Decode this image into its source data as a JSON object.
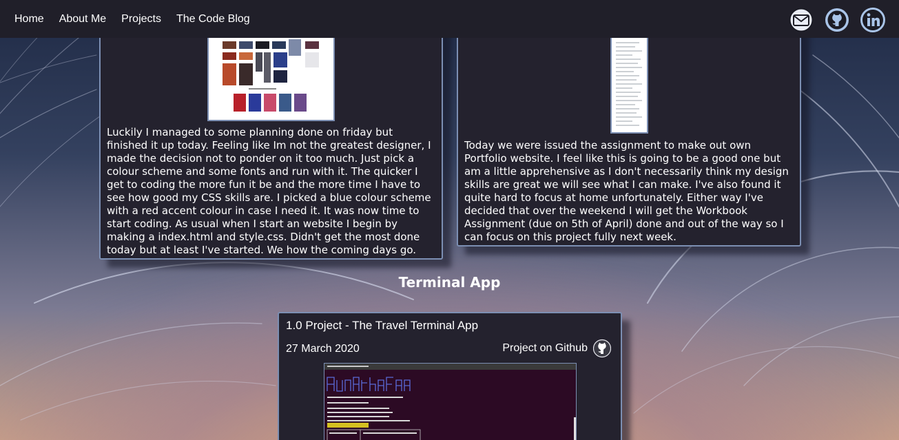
{
  "nav": {
    "links": [
      "Home",
      "About Me",
      "Projects",
      "The Code Blog"
    ],
    "icons": [
      "email-icon",
      "github-icon",
      "linkedin-icon"
    ]
  },
  "blog": {
    "left_post": "Luckily I managed to some planning done on friday but finished it up today. Feeling like Im not the greatest designer, I made the decision not to ponder on it too much. Just pick a colour scheme and some fonts and run with it. The quicker I get to coding the more fun it be and the more time I have to see how good my CSS skills are. I picked a blue colour scheme with a red accent colour in case I need it. It was now time to start coding. As usual when I start an website I begin by making a index.html and style.css. Didn't get the most done today but at least I've started. We how the coming days go.",
    "right_post": "Today we were issued the assignment to make out own Portfolio website. I feel like this is going to be a good one but am a little apprehensive as I don't necessarily think my design skills are great we will see what I can make. I've also found it quite hard to focus at home unfortunately. Either way I've decided that over the weekend I will get the Workbook Assignment (due on 5th of April) done and out of the way so I can focus on this project fully next week."
  },
  "section": {
    "title": "Terminal App"
  },
  "project": {
    "title": "1.0 Project - The Travel Terminal App",
    "date": "27 March 2020",
    "github_label": "Project on Github"
  },
  "colors": {
    "nav_bg": "#201f29",
    "card_bg": "#24222e",
    "card_border": "#7c8fb3",
    "terminal_bg": "#2c0a24"
  }
}
